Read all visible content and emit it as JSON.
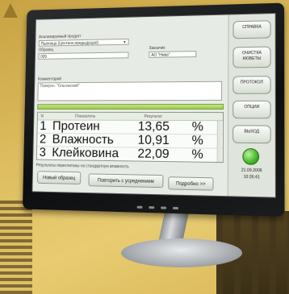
{
  "form": {
    "product_label": "Анализируемый продукт",
    "product_value": "Пшеница (Центино,предыдущая)",
    "sample_label": "Образец",
    "sample_value": "009",
    "customer_label": "Заказчик",
    "customer_value": "АО \"Нива\"",
    "comment_label": "Комментарий",
    "comment_value": "Поверхн. \"Ольгинский\""
  },
  "table": {
    "headers": {
      "num": "N",
      "indicator": "Показатель",
      "result": "Результат"
    },
    "rows": [
      {
        "num": "1",
        "name": "Протеин",
        "value": "13,65",
        "unit": "%"
      },
      {
        "num": "2",
        "name": "Влажность",
        "value": "10,91",
        "unit": "%"
      },
      {
        "num": "3",
        "name": "Клейковина",
        "value": "22,09",
        "unit": "%"
      }
    ]
  },
  "footnote": "Результаты пересчитаны на стандартную влажность",
  "buttons": {
    "new_sample": "Новый образец",
    "repeat": "Повторить с усреднением",
    "details": "Подробно >>"
  },
  "side": {
    "help": "СПРАВКА",
    "clean": "ОЧИСТКА КЮВЕТЫ",
    "protocol": "ПРОТОКОЛ",
    "options": "ОПЦИИ",
    "exit": "ВЫХОД",
    "date": "21.09.2006",
    "time": "10:26:41"
  },
  "colors": {
    "background": "#dcbc5e",
    "status_light": "#46b52a",
    "progress_bar": "#9ccb4d"
  }
}
